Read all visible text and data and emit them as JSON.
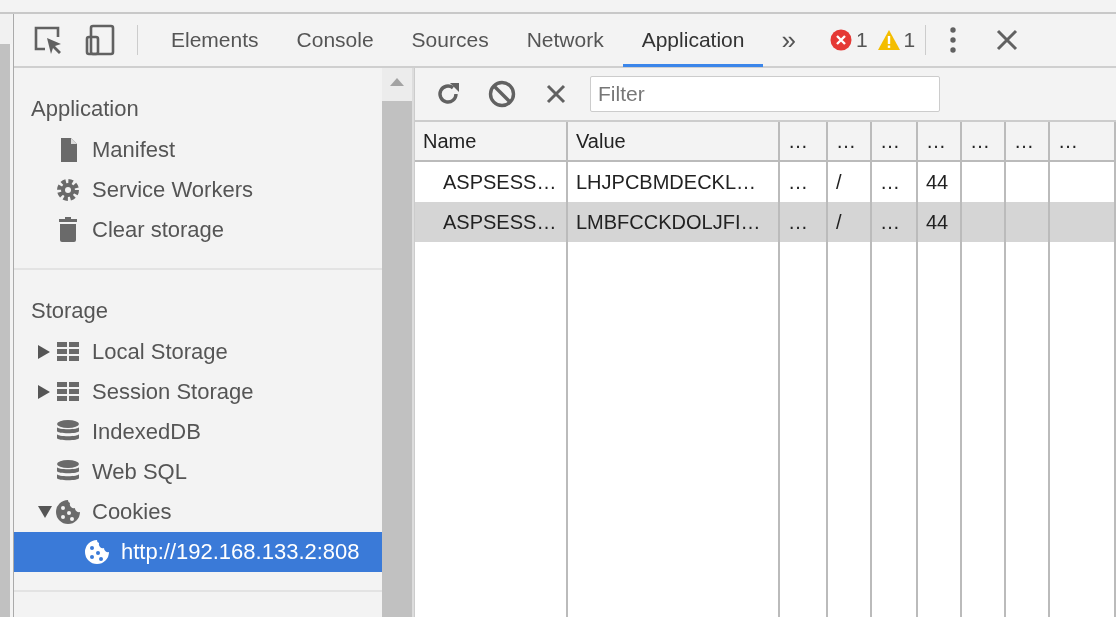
{
  "toolbar": {
    "tabs": [
      {
        "label": "Elements",
        "selected": false
      },
      {
        "label": "Console",
        "selected": false
      },
      {
        "label": "Sources",
        "selected": false
      },
      {
        "label": "Network",
        "selected": false
      },
      {
        "label": "Application",
        "selected": true
      }
    ],
    "more": "»",
    "errors": "1",
    "warnings": "1"
  },
  "sidebar": {
    "sections": [
      {
        "title": "Application",
        "items": [
          {
            "label": "Manifest",
            "kind": "manifest",
            "selected": false
          },
          {
            "label": "Service Workers",
            "kind": "service-workers",
            "selected": false
          },
          {
            "label": "Clear storage",
            "kind": "clear-storage",
            "selected": false
          }
        ]
      },
      {
        "title": "Storage",
        "items": [
          {
            "label": "Local Storage",
            "kind": "local-storage",
            "expanded": false,
            "selected": false
          },
          {
            "label": "Session Storage",
            "kind": "session-storage",
            "expanded": false,
            "selected": false
          },
          {
            "label": "IndexedDB",
            "kind": "indexeddb",
            "selected": false
          },
          {
            "label": "Web SQL",
            "kind": "websql",
            "selected": false
          },
          {
            "label": "Cookies",
            "kind": "cookies",
            "expanded": true,
            "selected": false,
            "children": [
              {
                "label": "http://192.168.133.2:808",
                "kind": "cookie-origin",
                "selected": true
              }
            ]
          }
        ]
      }
    ]
  },
  "filter": {
    "placeholder": "Filter"
  },
  "table": {
    "columns": [
      "Name",
      "Value",
      "…",
      "…",
      "…",
      "…",
      "…",
      "…",
      "…"
    ],
    "rows": [
      {
        "cells": [
          "ASPSESS…",
          "LHJPCBMDECKL…",
          "…",
          "/",
          "…",
          "44"
        ],
        "selected": false
      },
      {
        "cells": [
          "ASPSESS…",
          "LMBFCCKDOLJFI…",
          "…",
          "/",
          "…",
          "44"
        ],
        "selected": true
      }
    ]
  }
}
